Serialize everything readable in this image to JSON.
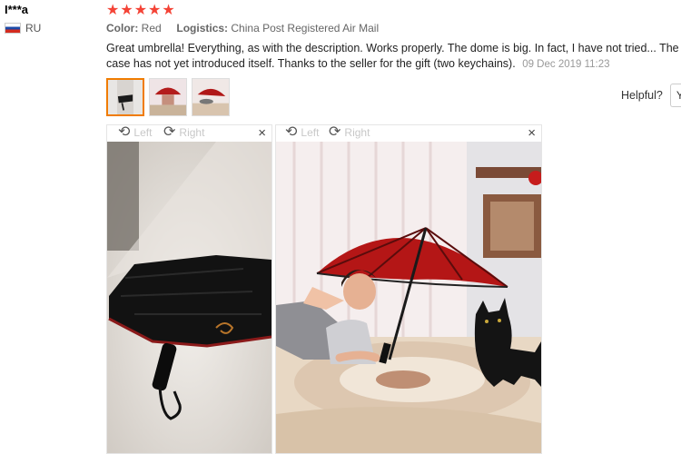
{
  "review": {
    "user_name": "I***a",
    "country_code": "RU",
    "stars": "★★★★★",
    "color_label": "Color:",
    "color_value": "Red",
    "logistics_label": "Logistics:",
    "logistics_value": "China Post Registered Air Mail",
    "text": "Great umbrella! Everything, as with the description. Works properly. The dome is big. In fact, I have not tried... The case has not yet introduced itself. Thanks to the seller for the gift (two keychains).",
    "date": "09 Dec 2019 11:23"
  },
  "helpful": {
    "label": "Helpful?",
    "yes_label": "Y"
  },
  "viewers": [
    {
      "left_label": "Left",
      "right_label": "Right",
      "close": "×"
    },
    {
      "left_label": "Left",
      "right_label": "Right",
      "close": "×"
    }
  ],
  "icons": {
    "rotate_left": "⟲",
    "rotate_right": "⟳"
  },
  "colors": {
    "star": "#f44336",
    "thumb_active": "#f07c00"
  }
}
